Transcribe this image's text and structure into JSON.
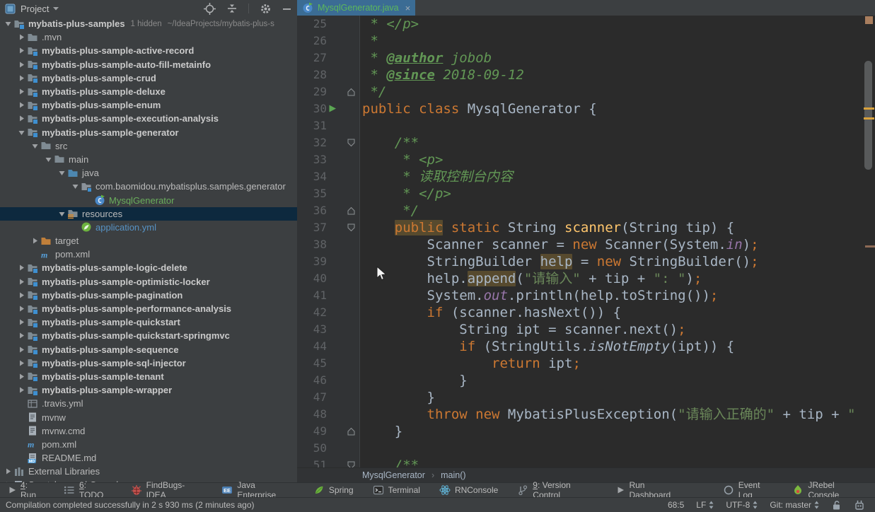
{
  "colors": {
    "panel_bg": "#3C3F41",
    "editor_bg": "#2B2B2B",
    "gutter_bg": "#313335",
    "selection_row": "#0D293E",
    "tab_active_bg": "#3B6C94",
    "tab_title_green": "#5CB85C",
    "keyword": "#CC7832",
    "string": "#6A8759",
    "doc_comment": "#629755",
    "plain_code": "#A9B7C6",
    "method_decl": "#FFC66D",
    "line_number": "#606366",
    "new_file_green": "#6AAE5C",
    "modified_file_blue": "#5692C4",
    "stripe_square": "#A97E5E",
    "stripe_orange": "#D9A23C"
  },
  "project_panel": {
    "title": "Project",
    "header_icons": [
      "locate",
      "collapse",
      "settings",
      "hide"
    ],
    "tree": [
      {
        "label": "mybatis-plus-samples",
        "level": 0,
        "arrow": "open",
        "icon": "module",
        "bold": true,
        "extras": [
          "1 hidden",
          "~/IdeaProjects/mybatis-plus-s"
        ]
      },
      {
        "label": ".mvn",
        "level": 1,
        "arrow": "closed",
        "icon": "folder"
      },
      {
        "label": "mybatis-plus-sample-active-record",
        "level": 1,
        "arrow": "closed",
        "icon": "module",
        "bold": true
      },
      {
        "label": "mybatis-plus-sample-auto-fill-metainfo",
        "level": 1,
        "arrow": "closed",
        "icon": "module",
        "bold": true
      },
      {
        "label": "mybatis-plus-sample-crud",
        "level": 1,
        "arrow": "closed",
        "icon": "module",
        "bold": true
      },
      {
        "label": "mybatis-plus-sample-deluxe",
        "level": 1,
        "arrow": "closed",
        "icon": "module",
        "bold": true
      },
      {
        "label": "mybatis-plus-sample-enum",
        "level": 1,
        "arrow": "closed",
        "icon": "module",
        "bold": true
      },
      {
        "label": "mybatis-plus-sample-execution-analysis",
        "level": 1,
        "arrow": "closed",
        "icon": "module",
        "bold": true
      },
      {
        "label": "mybatis-plus-sample-generator",
        "level": 1,
        "arrow": "open",
        "icon": "module",
        "bold": true
      },
      {
        "label": "src",
        "level": 2,
        "arrow": "open",
        "icon": "folder"
      },
      {
        "label": "main",
        "level": 3,
        "arrow": "open",
        "icon": "folder"
      },
      {
        "label": "java",
        "level": 4,
        "arrow": "open",
        "icon": "folder-java"
      },
      {
        "label": "com.baomidou.mybatisplus.samples.generator",
        "level": 5,
        "arrow": "open",
        "icon": "package"
      },
      {
        "label": "MysqlGenerator",
        "level": 6,
        "arrow": "none",
        "icon": "class",
        "color": "green"
      },
      {
        "label": "resources",
        "level": 4,
        "arrow": "open",
        "icon": "folder-resources",
        "selected": true
      },
      {
        "label": "application.yml",
        "level": 5,
        "arrow": "none",
        "icon": "spring-yml",
        "color": "blue"
      },
      {
        "label": "target",
        "level": 2,
        "arrow": "closed",
        "icon": "folder-excluded"
      },
      {
        "label": "pom.xml",
        "level": 2,
        "arrow": "none",
        "icon": "maven"
      },
      {
        "label": "mybatis-plus-sample-logic-delete",
        "level": 1,
        "arrow": "closed",
        "icon": "module",
        "bold": true
      },
      {
        "label": "mybatis-plus-sample-optimistic-locker",
        "level": 1,
        "arrow": "closed",
        "icon": "module",
        "bold": true
      },
      {
        "label": "mybatis-plus-sample-pagination",
        "level": 1,
        "arrow": "closed",
        "icon": "module",
        "bold": true
      },
      {
        "label": "mybatis-plus-sample-performance-analysis",
        "level": 1,
        "arrow": "closed",
        "icon": "module",
        "bold": true
      },
      {
        "label": "mybatis-plus-sample-quickstart",
        "level": 1,
        "arrow": "closed",
        "icon": "module",
        "bold": true
      },
      {
        "label": "mybatis-plus-sample-quickstart-springmvc",
        "level": 1,
        "arrow": "closed",
        "icon": "module",
        "bold": true
      },
      {
        "label": "mybatis-plus-sample-sequence",
        "level": 1,
        "arrow": "closed",
        "icon": "module",
        "bold": true
      },
      {
        "label": "mybatis-plus-sample-sql-injector",
        "level": 1,
        "arrow": "closed",
        "icon": "module",
        "bold": true
      },
      {
        "label": "mybatis-plus-sample-tenant",
        "level": 1,
        "arrow": "closed",
        "icon": "module",
        "bold": true
      },
      {
        "label": "mybatis-plus-sample-wrapper",
        "level": 1,
        "arrow": "closed",
        "icon": "module",
        "bold": true
      },
      {
        "label": ".travis.yml",
        "level": 1,
        "arrow": "none",
        "icon": "grid-yml"
      },
      {
        "label": "mvnw",
        "level": 1,
        "arrow": "none",
        "icon": "text-file"
      },
      {
        "label": "mvnw.cmd",
        "level": 1,
        "arrow": "none",
        "icon": "text-file"
      },
      {
        "label": "pom.xml",
        "level": 1,
        "arrow": "none",
        "icon": "maven"
      },
      {
        "label": "README.md",
        "level": 1,
        "arrow": "none",
        "icon": "md-file"
      },
      {
        "label": "External Libraries",
        "level": 0,
        "arrow": "closed",
        "icon": "ext-lib"
      },
      {
        "label": "Scratches and Consoles",
        "level": 0,
        "arrow": "closed",
        "icon": "scratches"
      }
    ]
  },
  "editor": {
    "tab": {
      "title": "MysqlGenerator.java",
      "icon": "class",
      "close": "×"
    },
    "breadcrumbs": [
      "MysqlGenerator",
      "main()"
    ],
    "lines": [
      {
        "n": 25,
        "s": [
          {
            "t": " * </p>",
            "c": "doc"
          }
        ]
      },
      {
        "n": 26,
        "s": [
          {
            "t": " *",
            "c": "doc"
          }
        ]
      },
      {
        "n": 27,
        "s": [
          {
            "t": " * ",
            "c": "doc"
          },
          {
            "t": "@author",
            "c": "doctag"
          },
          {
            "t": " jobob",
            "c": "doc"
          }
        ]
      },
      {
        "n": 28,
        "s": [
          {
            "t": " * ",
            "c": "doc"
          },
          {
            "t": "@since",
            "c": "doctag"
          },
          {
            "t": " 2018-09-12",
            "c": "doc"
          }
        ]
      },
      {
        "n": 29,
        "g": "fold-up",
        "s": [
          {
            "t": " */",
            "c": "doc"
          }
        ]
      },
      {
        "n": 30,
        "g": "run",
        "s": [
          {
            "t": "public class ",
            "c": "kw"
          },
          {
            "t": "MysqlGenerator {",
            "c": "plain"
          }
        ]
      },
      {
        "n": 31,
        "s": []
      },
      {
        "n": 32,
        "g": "fold-down",
        "s": [
          {
            "t": "    ",
            "c": "plain"
          },
          {
            "t": "/**",
            "c": "doc"
          }
        ]
      },
      {
        "n": 33,
        "s": [
          {
            "t": "     * <p>",
            "c": "doc"
          }
        ]
      },
      {
        "n": 34,
        "s": [
          {
            "t": "     * 读取控制台内容",
            "c": "doc"
          }
        ]
      },
      {
        "n": 35,
        "s": [
          {
            "t": "     * </p>",
            "c": "doc"
          }
        ]
      },
      {
        "n": 36,
        "g": "fold-up",
        "s": [
          {
            "t": "     */",
            "c": "doc"
          }
        ]
      },
      {
        "n": 37,
        "g": "fold-down",
        "s": [
          {
            "t": "    ",
            "c": "plain"
          },
          {
            "t": "public",
            "c": "kw",
            "h": true
          },
          {
            "t": " static ",
            "c": "kw"
          },
          {
            "t": "String ",
            "c": "plain"
          },
          {
            "t": "scanner",
            "c": "meth"
          },
          {
            "t": "(String tip) {",
            "c": "plain"
          }
        ]
      },
      {
        "n": 38,
        "s": [
          {
            "t": "        Scanner scanner = ",
            "c": "plain"
          },
          {
            "t": "new",
            "c": "kw"
          },
          {
            "t": " Scanner(System.",
            "c": "plain"
          },
          {
            "t": "in",
            "c": "field"
          },
          {
            "t": ")",
            "c": "plain"
          },
          {
            "t": ";",
            "c": "semi"
          }
        ]
      },
      {
        "n": 39,
        "s": [
          {
            "t": "        StringBuilder ",
            "c": "plain"
          },
          {
            "t": "help",
            "c": "plain",
            "h": true
          },
          {
            "t": " = ",
            "c": "plain"
          },
          {
            "t": "new",
            "c": "kw"
          },
          {
            "t": " StringBuilder()",
            "c": "plain"
          },
          {
            "t": ";",
            "c": "semi"
          }
        ]
      },
      {
        "n": 40,
        "s": [
          {
            "t": "        help.",
            "c": "plain"
          },
          {
            "t": "append",
            "c": "plain",
            "h": true
          },
          {
            "t": "(",
            "c": "plain"
          },
          {
            "t": "\"请输入\"",
            "c": "str"
          },
          {
            "t": " + tip + ",
            "c": "plain"
          },
          {
            "t": "\": \"",
            "c": "str"
          },
          {
            "t": ")",
            "c": "plain"
          },
          {
            "t": ";",
            "c": "semi"
          }
        ]
      },
      {
        "n": 41,
        "s": [
          {
            "t": "        System.",
            "c": "plain"
          },
          {
            "t": "out",
            "c": "field"
          },
          {
            "t": ".println(help.toString())",
            "c": "plain"
          },
          {
            "t": ";",
            "c": "semi"
          }
        ]
      },
      {
        "n": 42,
        "s": [
          {
            "t": "        ",
            "c": "plain"
          },
          {
            "t": "if",
            "c": "kw"
          },
          {
            "t": " (scanner.hasNext()) {",
            "c": "plain"
          }
        ]
      },
      {
        "n": 43,
        "s": [
          {
            "t": "            String ipt = scanner.next()",
            "c": "plain"
          },
          {
            "t": ";",
            "c": "semi"
          }
        ]
      },
      {
        "n": 44,
        "s": [
          {
            "t": "            ",
            "c": "plain"
          },
          {
            "t": "if",
            "c": "kw"
          },
          {
            "t": " (StringUtils.",
            "c": "plain"
          },
          {
            "t": "isNotEmpty",
            "c": "smeth"
          },
          {
            "t": "(ipt)) {",
            "c": "plain"
          }
        ]
      },
      {
        "n": 45,
        "s": [
          {
            "t": "                ",
            "c": "plain"
          },
          {
            "t": "return",
            "c": "kw"
          },
          {
            "t": " ipt",
            "c": "plain"
          },
          {
            "t": ";",
            "c": "semi"
          }
        ]
      },
      {
        "n": 46,
        "s": [
          {
            "t": "            }",
            "c": "plain"
          }
        ]
      },
      {
        "n": 47,
        "s": [
          {
            "t": "        }",
            "c": "plain"
          }
        ]
      },
      {
        "n": 48,
        "s": [
          {
            "t": "        ",
            "c": "plain"
          },
          {
            "t": "throw new ",
            "c": "kw"
          },
          {
            "t": "MybatisPlusException(",
            "c": "plain"
          },
          {
            "t": "\"请输入正确的\"",
            "c": "str"
          },
          {
            "t": " + tip + ",
            "c": "plain"
          },
          {
            "t": "\"",
            "c": "str"
          }
        ]
      },
      {
        "n": 49,
        "g": "fold-up",
        "s": [
          {
            "t": "    }",
            "c": "plain"
          }
        ]
      },
      {
        "n": 50,
        "s": []
      },
      {
        "n": 51,
        "g": "fold-down",
        "s": [
          {
            "t": "    ",
            "c": "plain"
          },
          {
            "t": "/**",
            "c": "doc"
          }
        ]
      }
    ]
  },
  "toolbar_bottom": {
    "left": [
      {
        "icon": "run-gray",
        "mnemonic": "4",
        "label": "Run"
      },
      {
        "icon": "todo",
        "mnemonic": "6",
        "label": "TODO"
      },
      {
        "icon": "bug",
        "label": "FindBugs-IDEA"
      },
      {
        "icon": "ee",
        "label": "Java Enterprise"
      },
      {
        "icon": "leaf",
        "label": "Spring"
      },
      {
        "icon": "terminal",
        "label": "Terminal"
      },
      {
        "icon": "react",
        "label": "RNConsole"
      },
      {
        "icon": "branch",
        "mnemonic": "9",
        "label": "Version Control"
      },
      {
        "icon": "run-gray",
        "label": "Run Dashboard"
      }
    ],
    "right": [
      {
        "icon": "event-ring",
        "label": "Event Log"
      },
      {
        "icon": "jrebel",
        "label": "JRebel Console"
      }
    ]
  },
  "status_bar": {
    "message": "Compilation completed successfully in 2 s 930 ms (2 minutes ago)",
    "position": "68:5",
    "line_ending": "LF",
    "encoding": "UTF-8",
    "git": "Git: master"
  }
}
